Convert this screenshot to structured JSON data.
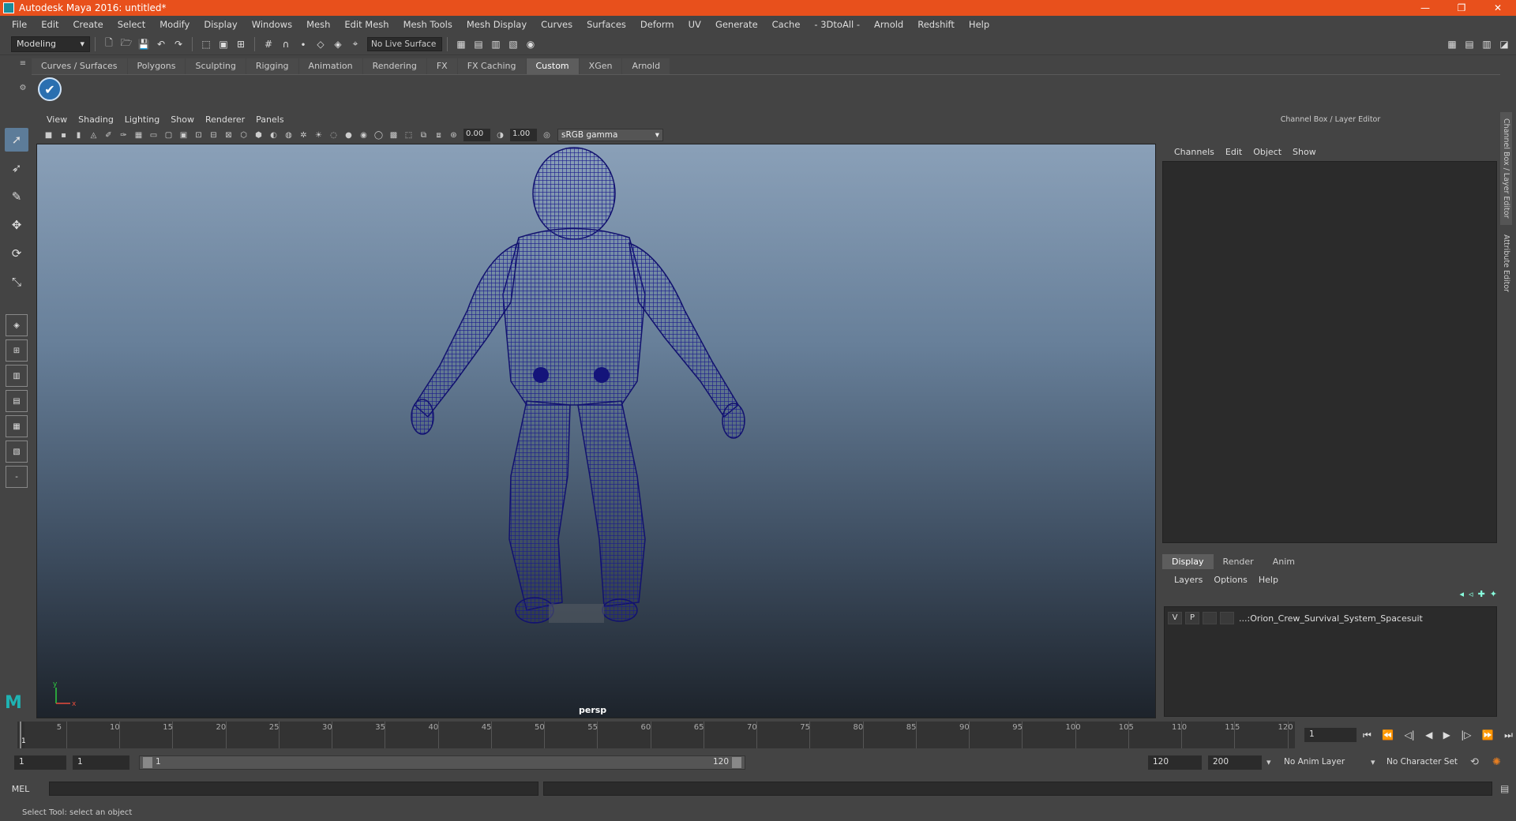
{
  "window": {
    "title": "Autodesk Maya 2016: untitled*",
    "controls": [
      "—",
      "❐",
      "✕"
    ]
  },
  "menubar": {
    "items": [
      "File",
      "Edit",
      "Create",
      "Select",
      "Modify",
      "Display",
      "Windows",
      "Mesh",
      "Edit Mesh",
      "Mesh Tools",
      "Mesh Display",
      "Curves",
      "Surfaces",
      "Deform",
      "UV",
      "Generate",
      "Cache",
      "- 3DtoAll -",
      "Arnold",
      "Redshift",
      "Help"
    ]
  },
  "statusline": {
    "mode": "Modeling",
    "live_surface": "No Live Surface"
  },
  "shelf": {
    "tabs": [
      "Curves / Surfaces",
      "Polygons",
      "Sculpting",
      "Rigging",
      "Animation",
      "Rendering",
      "FX",
      "FX Caching",
      "Custom",
      "XGen",
      "Arnold"
    ],
    "active_tab": "Custom"
  },
  "viewport": {
    "menu": [
      "View",
      "Shading",
      "Lighting",
      "Show",
      "Renderer",
      "Panels"
    ],
    "exposure": "0.00",
    "gamma": "1.00",
    "color_space": "sRGB gamma",
    "camera": "persp",
    "axis_x": "x",
    "axis_y": "y",
    "mesh_color": "#1a1a8c"
  },
  "channel_box": {
    "title": "Channel Box / Layer Editor",
    "menu": [
      "Channels",
      "Edit",
      "Object",
      "Show"
    ],
    "side_tabs": [
      "Channel Box / Layer Editor",
      "Attribute Editor"
    ]
  },
  "layer_editor": {
    "tabs": [
      "Display",
      "Render",
      "Anim"
    ],
    "active_tab": "Display",
    "menu": [
      "Layers",
      "Options",
      "Help"
    ],
    "layers": [
      {
        "v": "V",
        "p": "P",
        "name": "...:Orion_Crew_Survival_System_Spacesuit"
      }
    ]
  },
  "timeline": {
    "ticks": [
      5,
      10,
      15,
      20,
      25,
      30,
      35,
      40,
      45,
      50,
      55,
      60,
      65,
      70,
      75,
      80,
      85,
      90,
      95,
      100,
      105,
      110,
      115,
      120
    ],
    "current_frame": "1",
    "frame_field": "1"
  },
  "range": {
    "start": "1",
    "inner_start": "1",
    "slider_start": "1",
    "slider_end": "120",
    "end": "120",
    "outer_end": "200",
    "anim_layer": "No Anim Layer",
    "character_set": "No Character Set"
  },
  "cmdline": {
    "label": "MEL"
  },
  "helpline": {
    "text": "Select Tool: select an object"
  }
}
